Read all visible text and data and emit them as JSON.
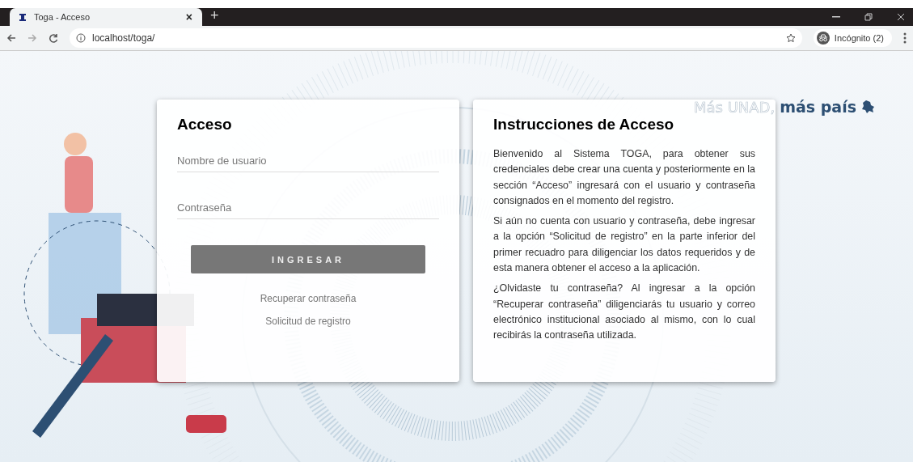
{
  "browser": {
    "tab": {
      "title": "Toga - Acceso",
      "close": "×"
    },
    "new_tab": "+",
    "address": "localhost/toga/",
    "profile": "Incógnito (2)"
  },
  "logo": {
    "light": "Más UNAD,",
    "bold": "más país"
  },
  "login": {
    "title": "Acceso",
    "fields": [
      {
        "placeholder": "Nombre de usuario"
      },
      {
        "placeholder": "Contraseña"
      }
    ],
    "button": "INGRESAR",
    "links": [
      "Recuperar contraseña",
      "Solicitud de registro"
    ]
  },
  "instructions": {
    "title": "Instrucciones de Acceso",
    "paragraphs": [
      "Bienvenido al Sistema TOGA, para obtener sus credenciales debe crear una cuenta y posteriormente en la sección “Acceso” ingresará con el usuario y contraseña consignados en el momento del registro.",
      "Si aún no cuenta con usuario y contraseña, debe ingresar a la opción “Solicitud de registro” en la parte inferior del primer recuadro para diligenciar los datos requeridos y de esta manera obtener el acceso a la aplicación.",
      "¿Olvidaste tu contraseña? Al ingresar a la opción “Recuperar contraseña” diligenciarás tu usuario y correo electrónico institucional asociado al mismo, con lo cual recibirás la contraseña utilizada."
    ]
  }
}
